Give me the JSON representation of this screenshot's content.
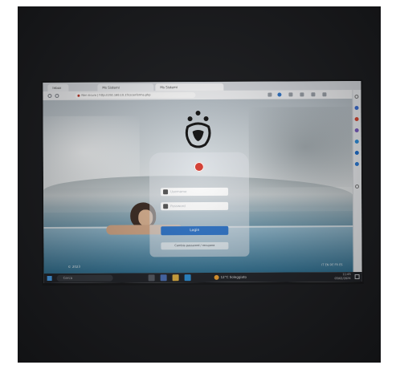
{
  "photo": {
    "description_icons": [
      "monitor",
      "pool-woman",
      "logo"
    ]
  },
  "browser": {
    "tabs": [
      {
        "label": "Inbox"
      },
      {
        "label": "Ms Sistemi"
      },
      {
        "label": "Ms Sistemi"
      }
    ],
    "address": "Non sicuro | http://192.168.10.151/conferma.php"
  },
  "login": {
    "username_placeholder": "Username",
    "password_placeholder": "Password",
    "login_label": "Login",
    "secondary_label": "Cambia password / recupera"
  },
  "page": {
    "bottom_left": "© 2023",
    "bottom_right": "IT EN DE FR ES"
  },
  "taskbar": {
    "search_placeholder": "Cerca",
    "weather": "12°C Soleggiato",
    "time": "11:43",
    "date": "03/02/2024"
  },
  "colors": {
    "accent": "#2f75c9",
    "badge": "#d23a2f"
  }
}
